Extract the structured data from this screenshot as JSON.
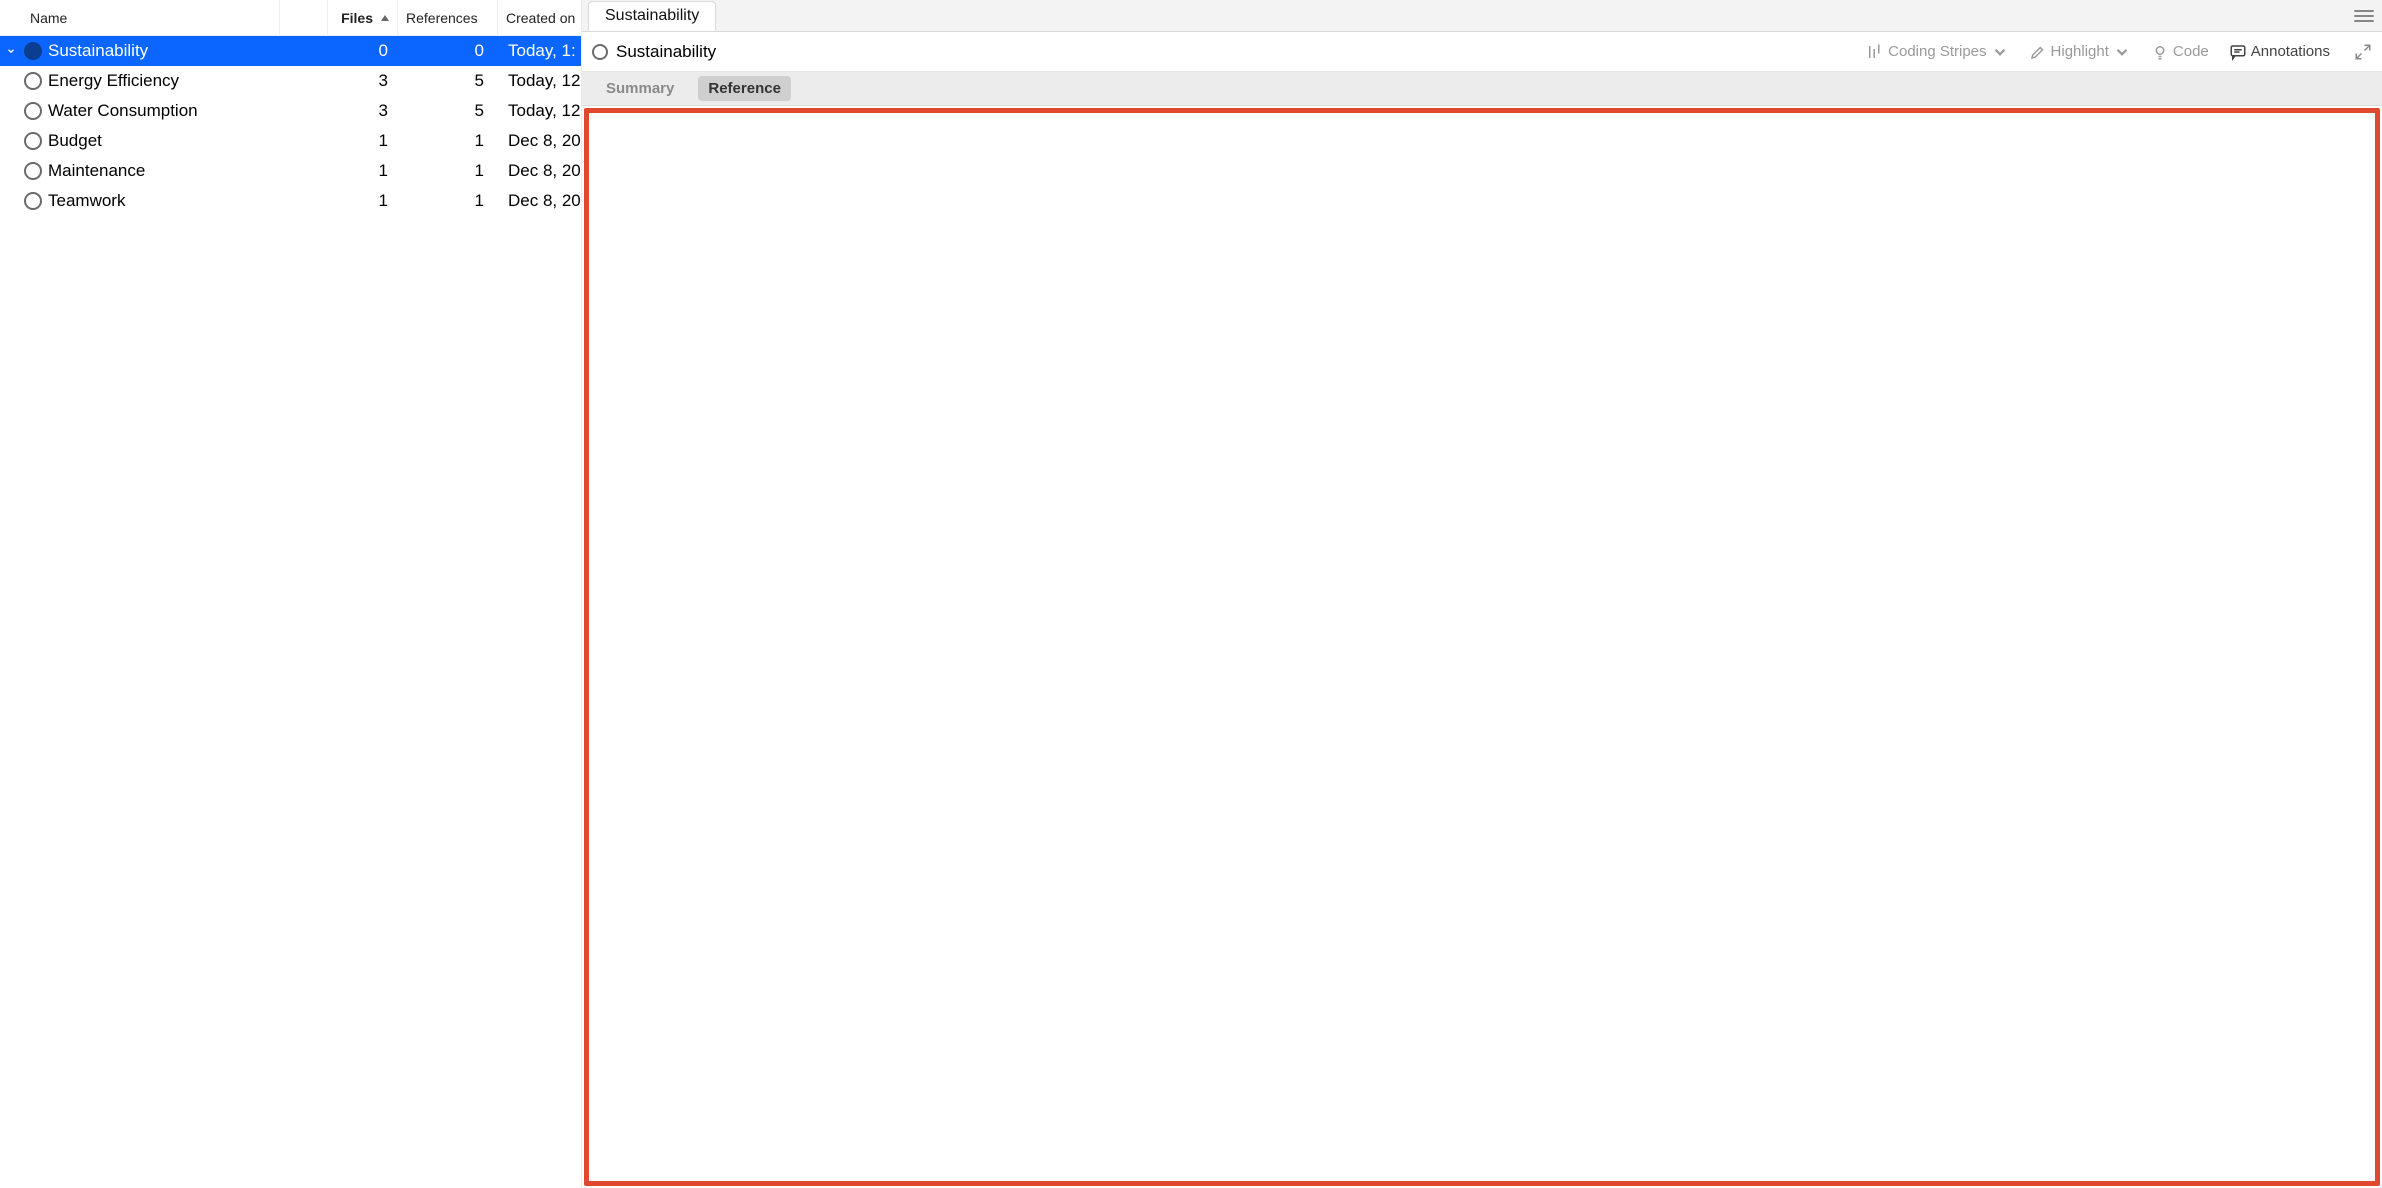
{
  "tree": {
    "columns": {
      "name": "Name",
      "files": "Files",
      "references": "References",
      "created": "Created on"
    },
    "rows": [
      {
        "name": "Sustainability",
        "files": "0",
        "refs": "0",
        "created": "Today, 1:",
        "level": 0,
        "expandable": true,
        "selected": true
      },
      {
        "name": "Energy Efficiency",
        "files": "3",
        "refs": "5",
        "created": "Today, 12",
        "level": 1,
        "expandable": false,
        "selected": false
      },
      {
        "name": "Water Consumption",
        "files": "3",
        "refs": "5",
        "created": "Today, 12",
        "level": 1,
        "expandable": false,
        "selected": false
      },
      {
        "name": "Budget",
        "files": "1",
        "refs": "1",
        "created": "Dec 8, 20",
        "level": 0,
        "expandable": false,
        "selected": false
      },
      {
        "name": "Maintenance",
        "files": "1",
        "refs": "1",
        "created": "Dec 8, 20",
        "level": 0,
        "expandable": false,
        "selected": false
      },
      {
        "name": "Teamwork",
        "files": "1",
        "refs": "1",
        "created": "Dec 8, 20",
        "level": 0,
        "expandable": false,
        "selected": false
      }
    ]
  },
  "detail": {
    "tab_label": "Sustainability",
    "title": "Sustainability",
    "tools": {
      "coding_stripes": "Coding Stripes",
      "highlight": "Highlight",
      "code": "Code",
      "annotations": "Annotations"
    },
    "subtabs": {
      "summary": "Summary",
      "reference": "Reference"
    }
  }
}
